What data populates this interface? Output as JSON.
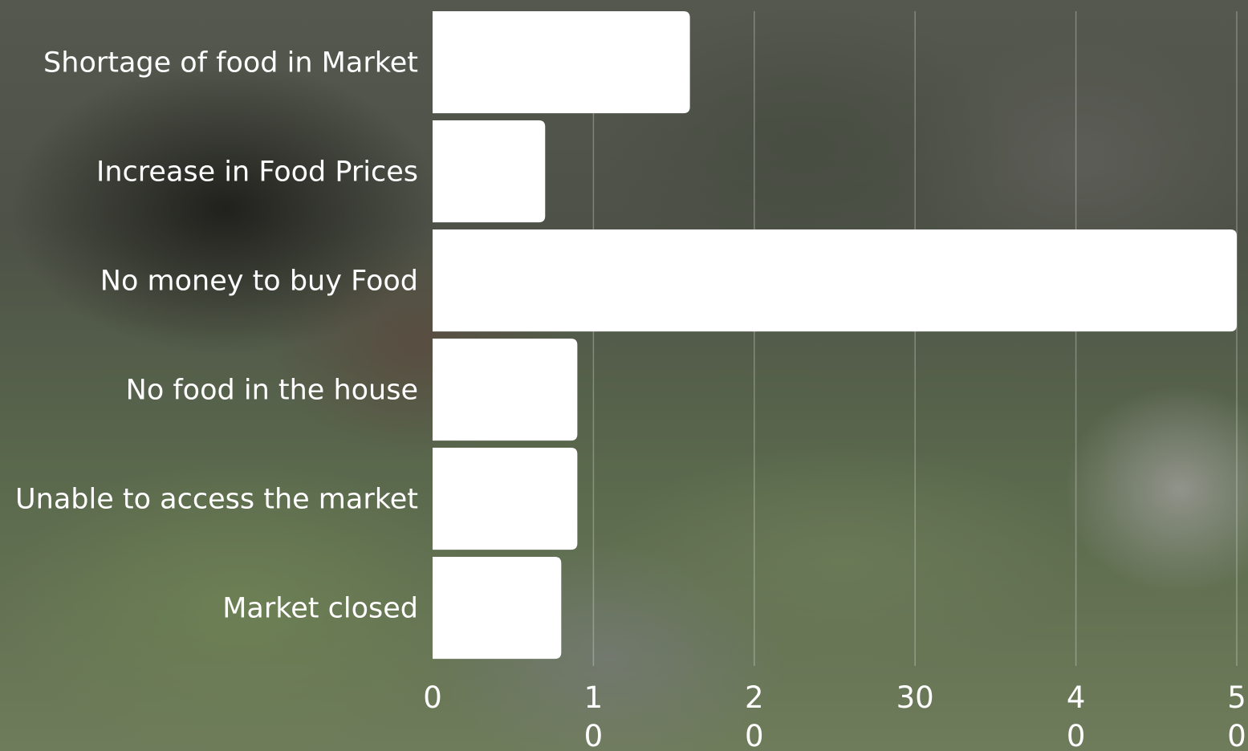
{
  "chart_data": {
    "type": "bar",
    "orientation": "horizontal",
    "categories": [
      "Shortage of food in Market",
      "Increase in Food Prices",
      "No money to buy Food",
      "No food in the house",
      "Unable to access the market",
      "Market closed"
    ],
    "values": [
      16,
      7,
      50,
      9,
      9,
      8
    ],
    "xlim": [
      0,
      50
    ],
    "x_ticks": [
      {
        "value": 0,
        "lines": [
          "0"
        ]
      },
      {
        "value": 10,
        "lines": [
          "1",
          "0"
        ]
      },
      {
        "value": 20,
        "lines": [
          "2",
          "0"
        ]
      },
      {
        "value": 30,
        "lines": [
          "30"
        ]
      },
      {
        "value": 40,
        "lines": [
          "4",
          "0"
        ]
      },
      {
        "value": 50,
        "lines": [
          "5",
          "0"
        ]
      }
    ],
    "grid": true,
    "bar_color": "#ffffff",
    "title": "",
    "xlabel": "",
    "ylabel": ""
  }
}
